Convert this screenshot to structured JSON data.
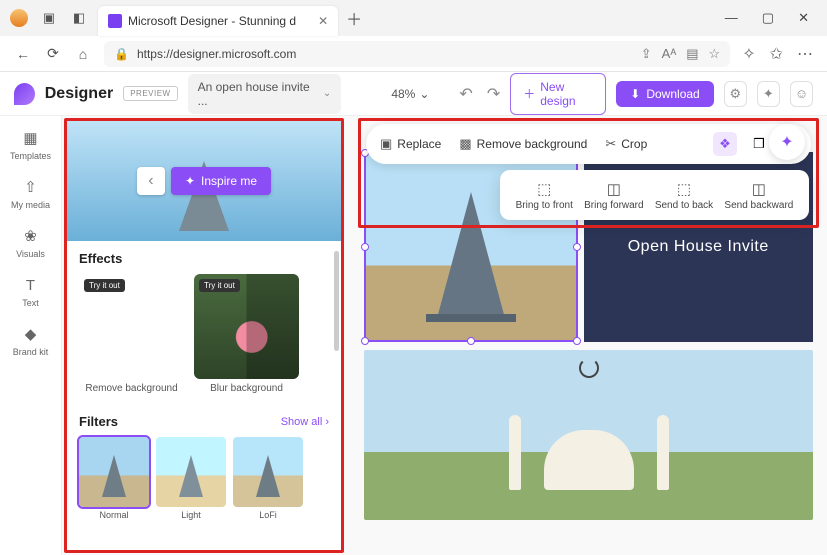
{
  "browser": {
    "tab_title": "Microsoft Designer - Stunning d",
    "url": "https://designer.microsoft.com"
  },
  "app": {
    "brand": "Designer",
    "preview_label": "PREVIEW",
    "project_name": "An open house invite ...",
    "zoom": "48%",
    "new_design_label": "New design",
    "download_label": "Download"
  },
  "sidebar": {
    "items": [
      {
        "label": "Templates"
      },
      {
        "label": "My media"
      },
      {
        "label": "Visuals"
      },
      {
        "label": "Text"
      },
      {
        "label": "Brand kit"
      }
    ]
  },
  "left_panel": {
    "inspire_label": "Inspire me",
    "effects_title": "Effects",
    "effects": [
      {
        "label": "Remove background",
        "tag": "Try it out"
      },
      {
        "label": "Blur background",
        "tag": "Try it out"
      }
    ],
    "filters_title": "Filters",
    "show_all": "Show all",
    "filters": [
      {
        "label": "Normal"
      },
      {
        "label": "Light"
      },
      {
        "label": "LoFi"
      }
    ]
  },
  "image_toolbar": {
    "replace": "Replace",
    "remove_bg": "Remove background",
    "crop": "Crop"
  },
  "arrange_menu": {
    "items": [
      {
        "label": "Bring to front"
      },
      {
        "label": "Bring forward"
      },
      {
        "label": "Send to back"
      },
      {
        "label": "Send backward"
      }
    ]
  },
  "canvas": {
    "text_block": "Open House Invite"
  }
}
